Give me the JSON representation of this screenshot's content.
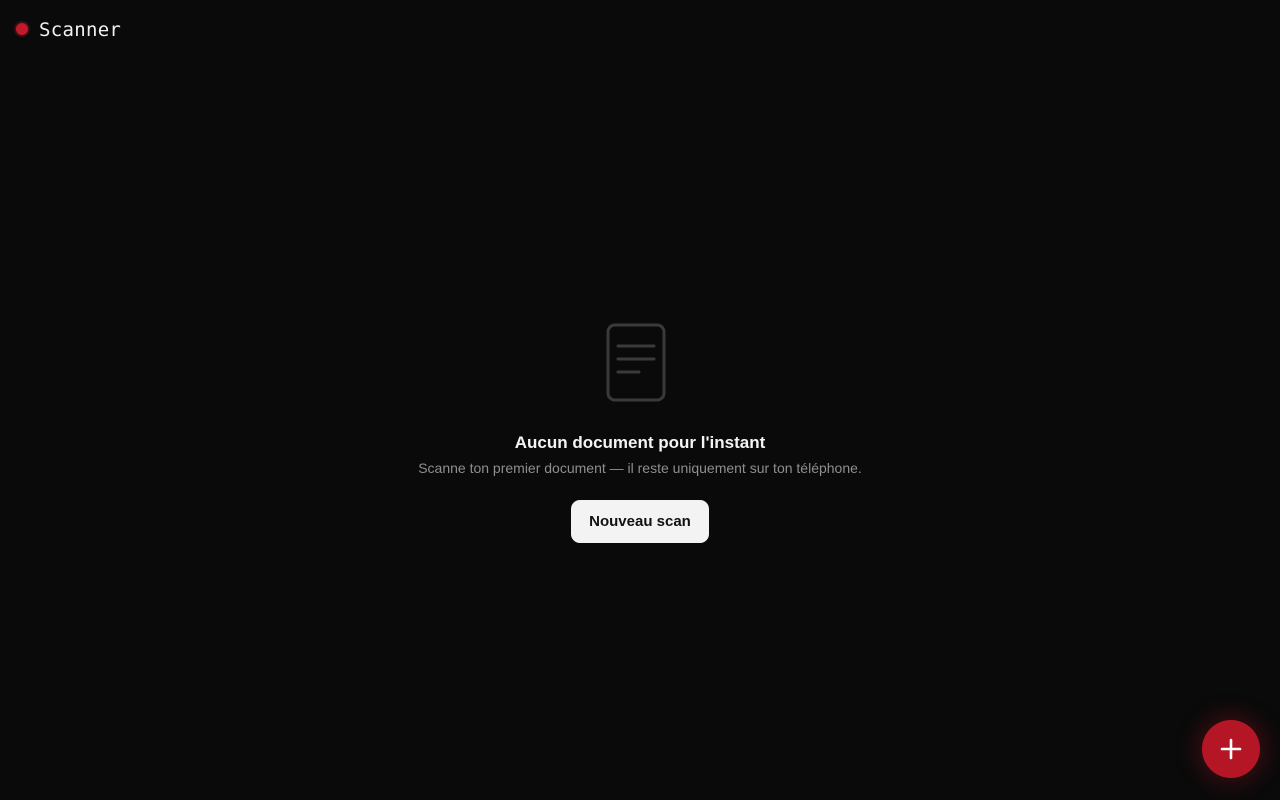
{
  "header": {
    "title": "Scanner",
    "indicator_icon": "record-dot-icon",
    "indicator_color": "#c21a2b"
  },
  "empty_state": {
    "icon": "document-icon",
    "title": "Aucun document pour l'instant",
    "subtitle": "Scanne ton premier document — il reste uniquement sur ton téléphone.",
    "button_label": "Nouveau scan"
  },
  "fab": {
    "icon": "plus-icon",
    "color": "#b51626"
  },
  "colors": {
    "background": "#0a0a0a",
    "accent": "#b51626",
    "button_bg": "#f3f3f3"
  }
}
